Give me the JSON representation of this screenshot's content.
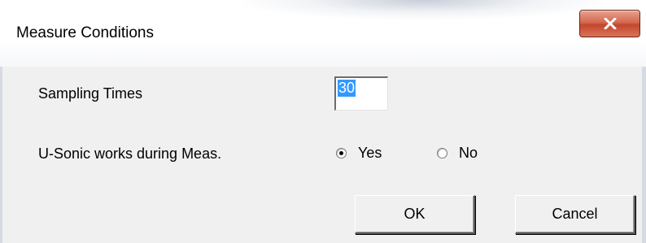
{
  "window": {
    "title": "Measure Conditions",
    "close_icon": "close-icon"
  },
  "form": {
    "sampling_label": "Sampling Times",
    "sampling_value": "30",
    "usonic_label": "U-Sonic works during Meas.",
    "radio_yes_label": "Yes",
    "radio_no_label": "No",
    "selected_option": "Yes"
  },
  "buttons": {
    "ok_label": "OK",
    "cancel_label": "Cancel"
  },
  "colors": {
    "dialog_face": "#f0f0f0",
    "selection_highlight": "#3399ff",
    "close_button": "#c3472c"
  }
}
